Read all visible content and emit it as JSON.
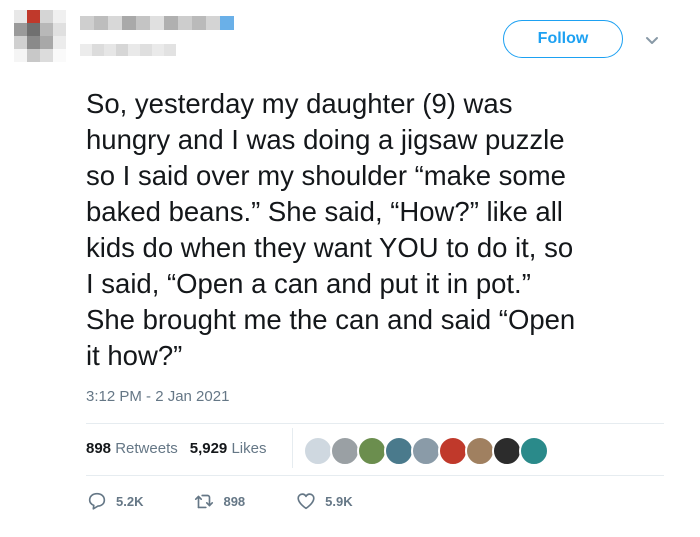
{
  "header": {
    "follow_label": "Follow"
  },
  "tweet": {
    "text": "So, yesterday my daughter (9) was\nhungry and I was doing a jigsaw puzzle\nso I said over my shoulder “make some\nbaked beans.” She said, “How?” like all\nkids do when they want YOU to do it, so\nI said, “Open a can and put it in pot.”\nShe brought me the can and said “Open\nit how?”",
    "timestamp": "3:12 PM - 2 Jan 2021"
  },
  "stats": {
    "retweets_count": "898",
    "retweets_label": "Retweets",
    "likes_count": "5,929",
    "likes_label": "Likes"
  },
  "likers": [
    "#cfd8e0",
    "#9aa0a4",
    "#6b8e4e",
    "#4a7a8c",
    "#8a9ba8",
    "#c0392b",
    "#a08060",
    "#2c2c2c",
    "#2a8a8a"
  ],
  "actions": {
    "replies": "5.2K",
    "retweets": "898",
    "likes": "5.9K"
  },
  "colors": {
    "accent": "#1da1f2",
    "muted": "#657786"
  }
}
